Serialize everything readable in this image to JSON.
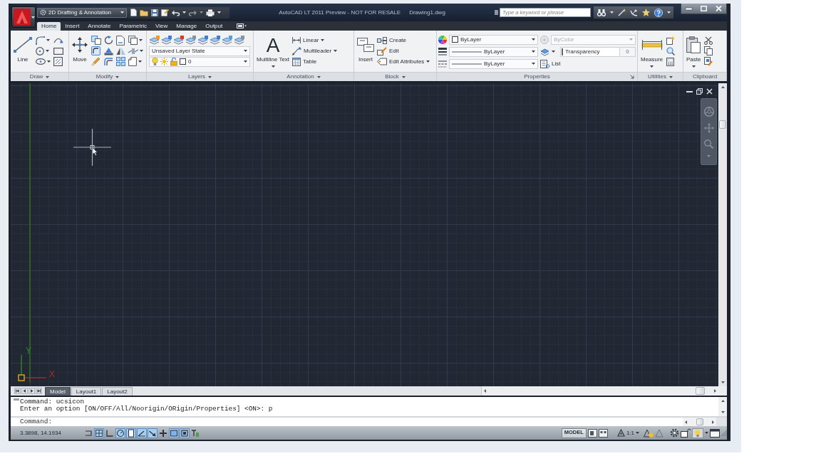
{
  "window": {
    "title": "AutoCAD LT 2011 Preview - NOT FOR RESALE",
    "document": "Drawing1.dwg"
  },
  "workspace": "2D Drafting & Annotation",
  "search": {
    "placeholder": "Type a keyword or phrase"
  },
  "ribbon_tabs": [
    {
      "label": "Home",
      "selected": true
    },
    {
      "label": "Insert",
      "selected": false
    },
    {
      "label": "Annotate",
      "selected": false
    },
    {
      "label": "Parametric",
      "selected": false
    },
    {
      "label": "View",
      "selected": false
    },
    {
      "label": "Manage",
      "selected": false
    },
    {
      "label": "Output",
      "selected": false
    }
  ],
  "ribbon_panels": [
    {
      "kind": "draw",
      "title": "Draw",
      "expandable": true,
      "button": {
        "label": "Line",
        "dropdown": false
      }
    },
    {
      "kind": "modify",
      "title": "Modify",
      "expandable": true,
      "button": {
        "label": "Move",
        "dropdown": false
      }
    },
    {
      "kind": "layers",
      "title": "Layers",
      "expandable": true,
      "layer_state": "Unsaved Layer State",
      "layer": "0"
    },
    {
      "kind": "annotation",
      "title": "Annotation",
      "expandable": true,
      "button": {
        "label": "Multiline Text",
        "glyph": "A",
        "dropdown": true
      },
      "tools": [
        {
          "label": "Linear",
          "dropdown": true
        },
        {
          "label": "Multileader",
          "dropdown": true
        },
        {
          "label": "Table",
          "dropdown": false
        }
      ]
    },
    {
      "kind": "block",
      "title": "Block",
      "expandable": true,
      "button": {
        "label": "Insert",
        "dropdown": false
      },
      "tools": [
        {
          "label": "Create",
          "dropdown": false
        },
        {
          "label": "Edit",
          "dropdown": false
        },
        {
          "label": "Edit Attributes",
          "dropdown": true
        }
      ]
    },
    {
      "kind": "properties",
      "title": "Properties",
      "expandable": false,
      "object_color": "ByLayer",
      "plot_style": {
        "value": "ByColor",
        "disabled": true
      },
      "lineweight": "ByLayer",
      "transparency": {
        "label": "Transparency",
        "value": "0",
        "level": 0
      },
      "linetype": "ByLayer",
      "list": "List"
    },
    {
      "kind": "utilities",
      "title": "Utilities",
      "expandable": true,
      "button": {
        "label": "Measure",
        "dropdown": true
      }
    },
    {
      "kind": "clipboard",
      "title": "Clipboard",
      "expandable": false,
      "button": {
        "label": "Paste",
        "dropdown": true
      }
    }
  ],
  "drawing": {
    "ucs": {
      "y_label": "Y",
      "x_label": "X"
    }
  },
  "layout_tabs": [
    {
      "label": "Model",
      "selected": true
    },
    {
      "label": "Layout1",
      "selected": false
    },
    {
      "label": "Layout2",
      "selected": false
    }
  ],
  "command_line": {
    "history": [
      "Command: ucsicon",
      "Enter an option [ON/OFF/All/Noorigin/ORigin/Properties] <ON>: p"
    ],
    "prompt": "Command:"
  },
  "status_bar": {
    "coordinates": "3.3898, 14.1934",
    "toggles": [
      {
        "on": false
      },
      {
        "on": true
      },
      {
        "on": false
      },
      {
        "on": true
      },
      {
        "on": true
      },
      {
        "on": true
      },
      {
        "on": true
      },
      {
        "on": false
      },
      {
        "on": true
      },
      {
        "on": true
      },
      {
        "on": false
      }
    ],
    "space": "MODEL",
    "annotation_scale": "1:1"
  }
}
